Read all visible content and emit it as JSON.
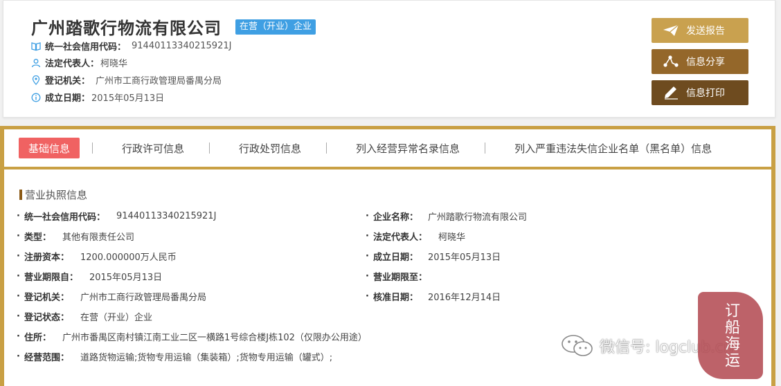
{
  "header": {
    "company_name": "广州踏歌行物流有限公司",
    "status_badge": "在营（开业）企业",
    "credit_code_label": "统一社会信用代码：",
    "credit_code_value": "91440113340215921J",
    "legal_rep_label": "法定代表人：",
    "legal_rep_value": "柯晓华",
    "reg_authority_label": "登记机关：",
    "reg_authority_value": "广州市工商行政管理局番禺分局",
    "found_date_label": "成立日期：",
    "found_date_value": "2015年05月13日"
  },
  "actions": {
    "report": "发送报告",
    "share": "信息分享",
    "print": "信息打印"
  },
  "tabs": [
    {
      "label": "基础信息",
      "active": true
    },
    {
      "label": "行政许可信息",
      "active": false
    },
    {
      "label": "行政处罚信息",
      "active": false
    },
    {
      "label": "列入经营异常名录信息",
      "active": false
    },
    {
      "label": "列入严重违法失信企业名单（黑名单）信息",
      "active": false
    }
  ],
  "license": {
    "section_title": "营业执照信息",
    "bullet": "·",
    "fields": {
      "credit_code": {
        "label": "统一社会信用代码：",
        "value": "91440113340215921J"
      },
      "company_name": {
        "label": "企业名称：",
        "value": "广州踏歌行物流有限公司"
      },
      "type": {
        "label": "类型：",
        "value": "其他有限责任公司"
      },
      "legal_rep": {
        "label": "法定代表人：",
        "value": "柯晓华"
      },
      "reg_capital": {
        "label": "注册资本：",
        "value": "1200.000000万人民币"
      },
      "found_date": {
        "label": "成立日期：",
        "value": "2015年05月13日"
      },
      "term_from": {
        "label": "营业期限自：",
        "value": "2015年05月13日"
      },
      "term_to": {
        "label": "营业期限至：",
        "value": ""
      },
      "reg_authority": {
        "label": "登记机关：",
        "value": "广州市工商行政管理局番禺分局"
      },
      "approval_date": {
        "label": "核准日期：",
        "value": "2016年12月14日"
      },
      "reg_status": {
        "label": "登记状态：",
        "value": "在营（开业）企业"
      },
      "address": {
        "label": "住所：",
        "value": "广州市番禺区南村镇江南工业二区一横路1号综合楼J栋102（仅限办公用途）"
      },
      "scope": {
        "label": "经营范围：",
        "value": "道路货物运输;货物专用运输（集装箱）;货物专用运输（罐式）;"
      }
    }
  },
  "watermark": {
    "text": "微信号: logclub.cn",
    "seal_text": "订船海运"
  },
  "colors": {
    "badge": "#3f9fe3",
    "report_btn": "#c9a14f",
    "share_btn": "#94672a",
    "print_btn": "#6e4b1f",
    "frame": "#c9a044",
    "active_tab": "#f06262"
  }
}
